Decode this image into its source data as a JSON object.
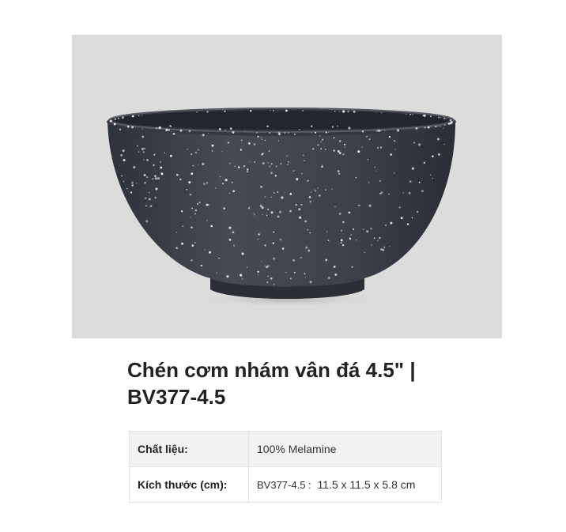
{
  "product": {
    "title": "Chén cơm nhám vân đá 4.5\" | BV377-4.5",
    "image": {
      "subject": "bowl",
      "background_color": "#dcdcdc",
      "bowl_color": "#3d414a",
      "speckle_color": "#ffffff"
    }
  },
  "specs": {
    "material": {
      "label": "Chất liệu:",
      "value": "100% Melamine"
    },
    "size": {
      "label": "Kích thước (cm):",
      "code": "BV377-4.5 :",
      "value": "11.5 x 11.5 x 5.8 cm"
    }
  }
}
